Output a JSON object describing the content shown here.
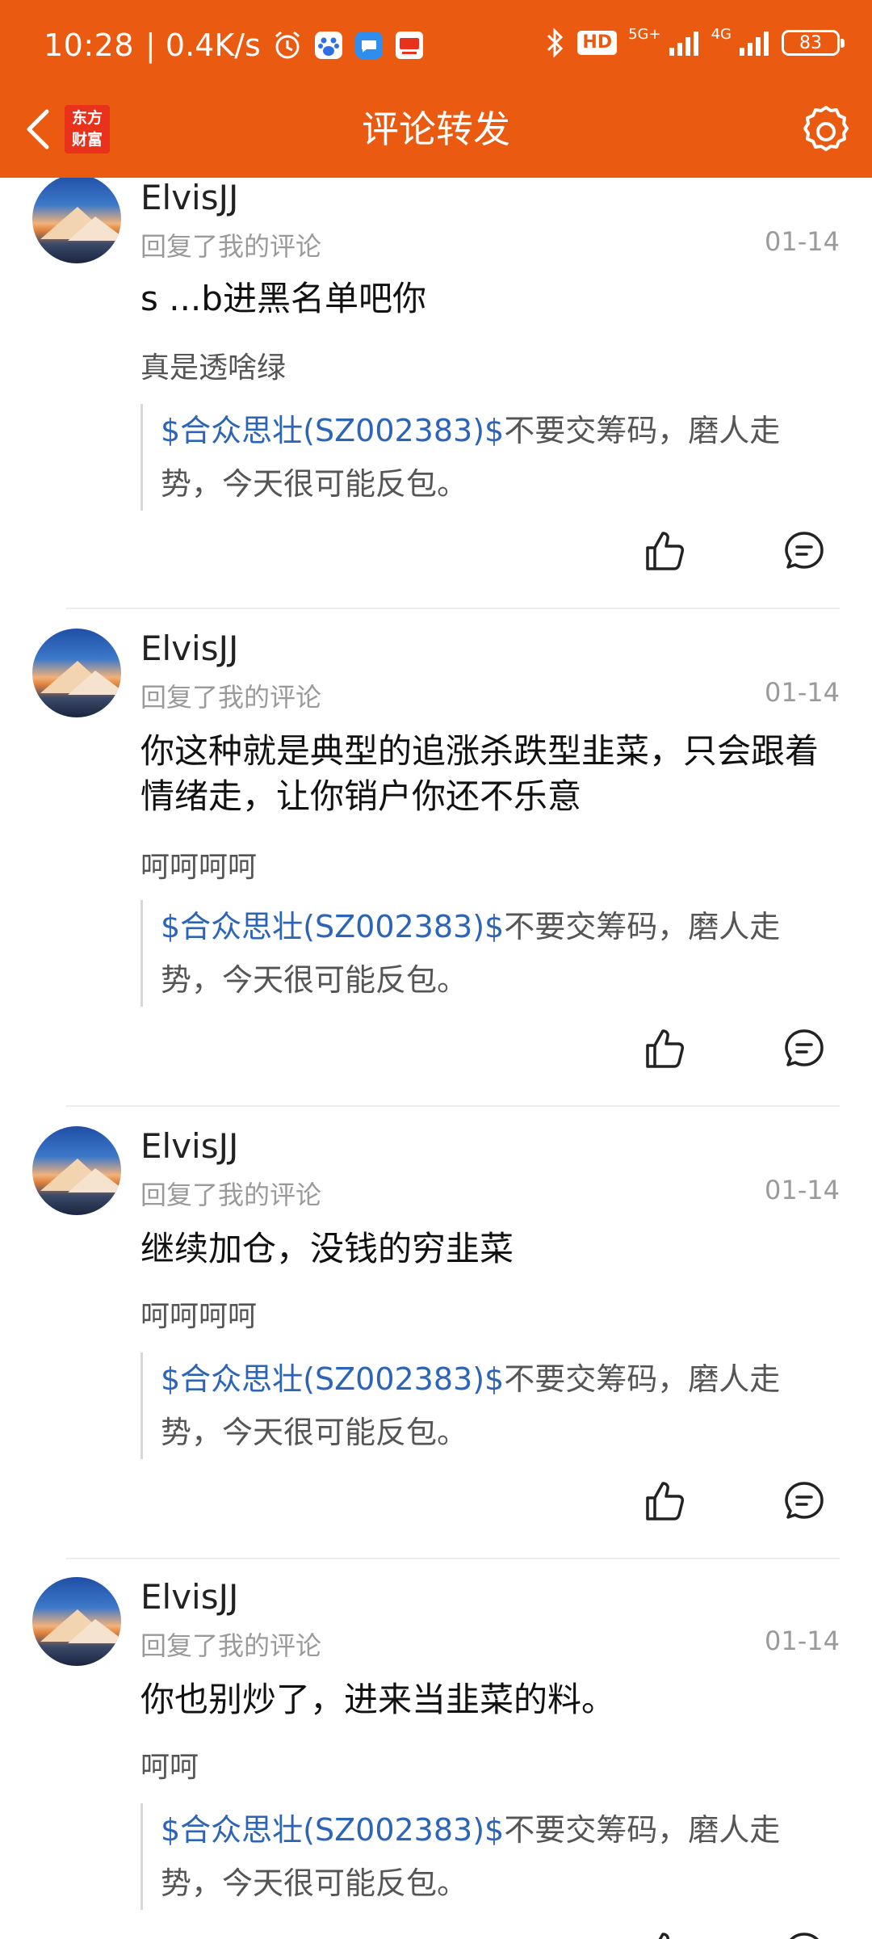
{
  "status_bar": {
    "time": "10:28",
    "speed": "| 0.4K/s",
    "network_5g": "5G+",
    "network_4g": "4G",
    "hd_badge": "HD",
    "battery": "83",
    "icons": [
      "alarm-icon",
      "baidu-icon",
      "message-app-icon",
      "news-app-icon",
      "bluetooth-icon",
      "signal-icon"
    ]
  },
  "nav": {
    "title": "评论转发",
    "logo_line1": "东方",
    "logo_line2": "财富",
    "back_icon": "chevron-left-icon",
    "settings_icon": "gear-icon"
  },
  "colors": {
    "brand": "#ea5a10",
    "stock_link": "#2c64b8",
    "meta_gray": "#9a9a9a"
  },
  "comments": [
    {
      "username": "ElvisJJ",
      "subtitle": "回复了我的评论",
      "date": "01-14",
      "reply": "s  ...b进黑名单吧你",
      "original": "真是透啥绿",
      "quote_stock": "$合众思壮(SZ002383)$",
      "quote_text": "不要交筹码，磨人走势，今天很可能反包。"
    },
    {
      "username": "ElvisJJ",
      "subtitle": "回复了我的评论",
      "date": "01-14",
      "reply": "你这种就是典型的追涨杀跌型韭菜，只会跟着情绪走，让你销户你还不乐意",
      "original": "呵呵呵呵",
      "quote_stock": "$合众思壮(SZ002383)$",
      "quote_text": "不要交筹码，磨人走势，今天很可能反包。"
    },
    {
      "username": "ElvisJJ",
      "subtitle": "回复了我的评论",
      "date": "01-14",
      "reply": "继续加仓，没钱的穷韭菜",
      "original": "呵呵呵呵",
      "quote_stock": "$合众思壮(SZ002383)$",
      "quote_text": "不要交筹码，磨人走势，今天很可能反包。"
    },
    {
      "username": "ElvisJJ",
      "subtitle": "回复了我的评论",
      "date": "01-14",
      "reply": "你也别炒了，进来当韭菜的料。",
      "original": "呵呵",
      "quote_stock": "$合众思壮(SZ002383)$",
      "quote_text": "不要交筹码，磨人走势，今天很可能反包。"
    }
  ]
}
